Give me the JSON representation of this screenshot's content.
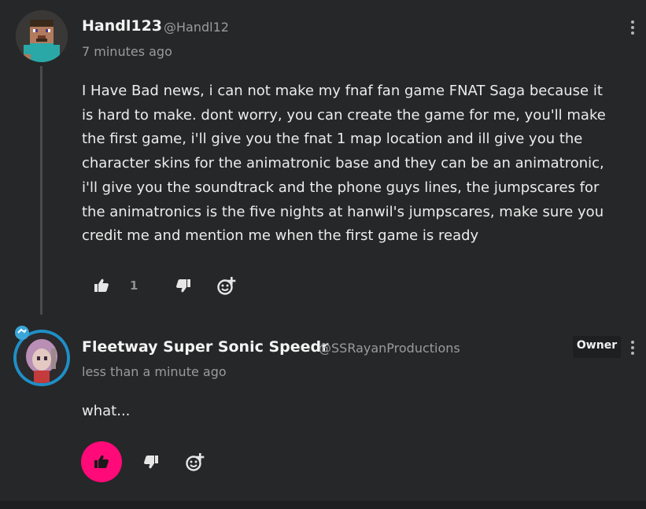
{
  "comments": [
    {
      "username": "Handl123",
      "handle": "@Handl12",
      "timestamp": "7 minutes ago",
      "body_lines": [
        "I Have Bad news, i can not make my fnaf fan game FNAT Saga because it",
        "is hard to make. dont worry, you can create the game for me, you'll make",
        "the first game, i'll give you the fnat 1 map location and ill give you the",
        "character skins for the animatronic base and they can be an animatronic,",
        "i'll give you the soundtrack and the phone guys lines, the jumpscares for",
        "the animatronics is the five nights at hanwil's jumpscares, make sure you",
        "credit me and mention me when the first game is ready"
      ],
      "like_count": "1",
      "liked": false
    },
    {
      "username": "Fleetway Super Sonic Speedr",
      "handle": "@SSRayanProductions",
      "timestamp": "less than a minute ago",
      "badge": "Owner",
      "body_lines": [
        "what..."
      ],
      "liked": true
    }
  ],
  "icons": {
    "like": "thumbs-up-icon",
    "dislike": "thumbs-down-icon",
    "react": "add-reaction-icon",
    "menu": "more-vertical-icon"
  },
  "colors": {
    "background": "#262728",
    "like_active": "#ff0a78",
    "owner_badge_bg": "#1e1f20",
    "avatar_ring": "#1f8fc7"
  }
}
